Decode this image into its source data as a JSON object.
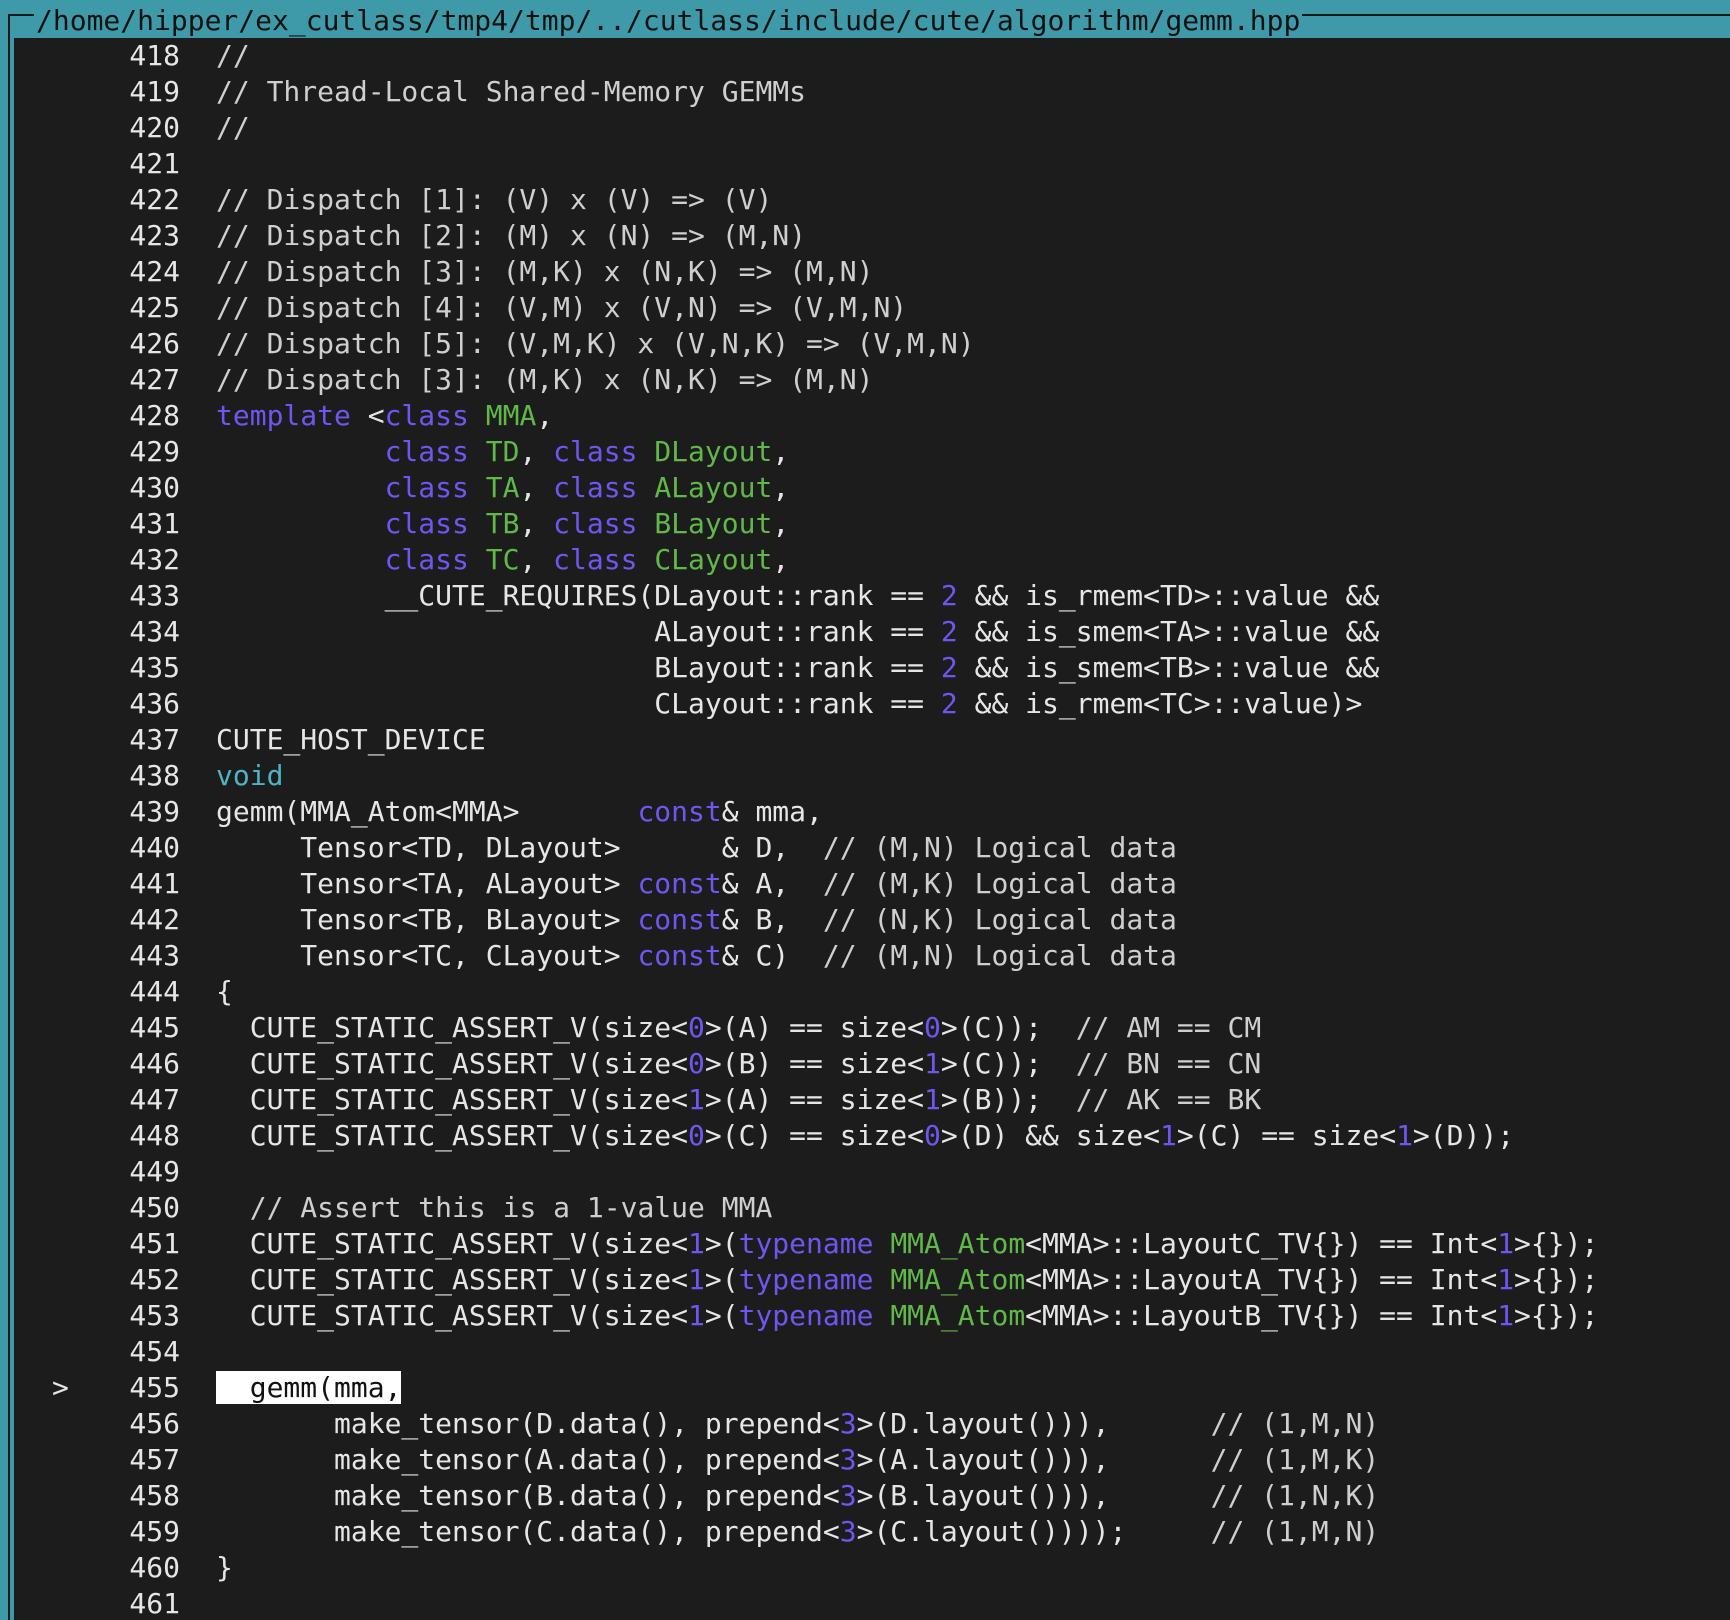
{
  "window": {
    "title": "/home/hipper/ex_cutlass/tmp4/tmp/../cutlass/include/cute/algorithm/gemm.hpp"
  },
  "editor": {
    "current_line_marker": ">",
    "current_line": 455,
    "colors": {
      "background": "#1c1c1c",
      "border": "#3e9aa8",
      "text": "#e6e6e6",
      "keyword": "#6f56f0",
      "type": "#5fb848",
      "number": "#6f56f0",
      "void": "#4eb3c3",
      "selection": "#ffffff"
    },
    "lines": [
      {
        "n": "418",
        "segs": [
          [
            "c",
            "//"
          ]
        ]
      },
      {
        "n": "419",
        "segs": [
          [
            "c",
            "// Thread-Local Shared-Memory GEMMs"
          ]
        ]
      },
      {
        "n": "420",
        "segs": [
          [
            "c",
            "//"
          ]
        ]
      },
      {
        "n": "421",
        "segs": []
      },
      {
        "n": "422",
        "segs": [
          [
            "c",
            "// Dispatch [1]: (V) x (V) => (V)"
          ]
        ]
      },
      {
        "n": "423",
        "segs": [
          [
            "c",
            "// Dispatch [2]: (M) x (N) => (M,N)"
          ]
        ]
      },
      {
        "n": "424",
        "segs": [
          [
            "c",
            "// Dispatch [3]: (M,K) x (N,K) => (M,N)"
          ]
        ]
      },
      {
        "n": "425",
        "segs": [
          [
            "c",
            "// Dispatch [4]: (V,M) x (V,N) => (V,M,N)"
          ]
        ]
      },
      {
        "n": "426",
        "segs": [
          [
            "c",
            "// Dispatch [5]: (V,M,K) x (V,N,K) => (V,M,N)"
          ]
        ]
      },
      {
        "n": "427",
        "segs": [
          [
            "c",
            "// Dispatch [3]: (M,K) x (N,K) => (M,N)"
          ]
        ]
      },
      {
        "n": "428",
        "segs": [
          [
            "k",
            "template"
          ],
          [
            "p",
            " <"
          ],
          [
            "k",
            "class"
          ],
          [
            "p",
            " "
          ],
          [
            "t",
            "MMA"
          ],
          [
            "p",
            ","
          ]
        ]
      },
      {
        "n": "429",
        "segs": [
          [
            "p",
            "          "
          ],
          [
            "k",
            "class"
          ],
          [
            "p",
            " "
          ],
          [
            "t",
            "TD"
          ],
          [
            "p",
            ", "
          ],
          [
            "k",
            "class"
          ],
          [
            "p",
            " "
          ],
          [
            "t",
            "DLayout"
          ],
          [
            "p",
            ","
          ]
        ]
      },
      {
        "n": "430",
        "segs": [
          [
            "p",
            "          "
          ],
          [
            "k",
            "class"
          ],
          [
            "p",
            " "
          ],
          [
            "t",
            "TA"
          ],
          [
            "p",
            ", "
          ],
          [
            "k",
            "class"
          ],
          [
            "p",
            " "
          ],
          [
            "t",
            "ALayout"
          ],
          [
            "p",
            ","
          ]
        ]
      },
      {
        "n": "431",
        "segs": [
          [
            "p",
            "          "
          ],
          [
            "k",
            "class"
          ],
          [
            "p",
            " "
          ],
          [
            "t",
            "TB"
          ],
          [
            "p",
            ", "
          ],
          [
            "k",
            "class"
          ],
          [
            "p",
            " "
          ],
          [
            "t",
            "BLayout"
          ],
          [
            "p",
            ","
          ]
        ]
      },
      {
        "n": "432",
        "segs": [
          [
            "p",
            "          "
          ],
          [
            "k",
            "class"
          ],
          [
            "p",
            " "
          ],
          [
            "t",
            "TC"
          ],
          [
            "p",
            ", "
          ],
          [
            "k",
            "class"
          ],
          [
            "p",
            " "
          ],
          [
            "t",
            "CLayout"
          ],
          [
            "p",
            ","
          ]
        ]
      },
      {
        "n": "433",
        "segs": [
          [
            "p",
            "          __CUTE_REQUIRES(DLayout::rank == "
          ],
          [
            "n",
            "2"
          ],
          [
            "p",
            " && is_rmem<TD>::value &&"
          ]
        ]
      },
      {
        "n": "434",
        "segs": [
          [
            "p",
            "                          ALayout::rank == "
          ],
          [
            "n",
            "2"
          ],
          [
            "p",
            " && is_smem<TA>::value &&"
          ]
        ]
      },
      {
        "n": "435",
        "segs": [
          [
            "p",
            "                          BLayout::rank == "
          ],
          [
            "n",
            "2"
          ],
          [
            "p",
            " && is_smem<TB>::value &&"
          ]
        ]
      },
      {
        "n": "436",
        "segs": [
          [
            "p",
            "                          CLayout::rank == "
          ],
          [
            "n",
            "2"
          ],
          [
            "p",
            " && is_rmem<TC>::value)>"
          ]
        ]
      },
      {
        "n": "437",
        "segs": [
          [
            "p",
            "CUTE_HOST_DEVICE"
          ]
        ]
      },
      {
        "n": "438",
        "segs": [
          [
            "v",
            "void"
          ]
        ]
      },
      {
        "n": "439",
        "segs": [
          [
            "p",
            "gemm(MMA_Atom<MMA>       "
          ],
          [
            "k",
            "const"
          ],
          [
            "p",
            "& mma,"
          ]
        ]
      },
      {
        "n": "440",
        "segs": [
          [
            "p",
            "     Tensor<TD, DLayout>      & D,  "
          ],
          [
            "c",
            "// (M,N) Logical data"
          ]
        ]
      },
      {
        "n": "441",
        "segs": [
          [
            "p",
            "     Tensor<TA, ALayout> "
          ],
          [
            "k",
            "const"
          ],
          [
            "p",
            "& A,  "
          ],
          [
            "c",
            "// (M,K) Logical data"
          ]
        ]
      },
      {
        "n": "442",
        "segs": [
          [
            "p",
            "     Tensor<TB, BLayout> "
          ],
          [
            "k",
            "const"
          ],
          [
            "p",
            "& B,  "
          ],
          [
            "c",
            "// (N,K) Logical data"
          ]
        ]
      },
      {
        "n": "443",
        "segs": [
          [
            "p",
            "     Tensor<TC, CLayout> "
          ],
          [
            "k",
            "const"
          ],
          [
            "p",
            "& C)  "
          ],
          [
            "c",
            "// (M,N) Logical data"
          ]
        ]
      },
      {
        "n": "444",
        "segs": [
          [
            "p",
            "{"
          ]
        ]
      },
      {
        "n": "445",
        "segs": [
          [
            "p",
            "  CUTE_STATIC_ASSERT_V(size<"
          ],
          [
            "n",
            "0"
          ],
          [
            "p",
            ">(A) == size<"
          ],
          [
            "n",
            "0"
          ],
          [
            "p",
            ">(C));  "
          ],
          [
            "c",
            "// AM == CM"
          ]
        ]
      },
      {
        "n": "446",
        "segs": [
          [
            "p",
            "  CUTE_STATIC_ASSERT_V(size<"
          ],
          [
            "n",
            "0"
          ],
          [
            "p",
            ">(B) == size<"
          ],
          [
            "n",
            "1"
          ],
          [
            "p",
            ">(C));  "
          ],
          [
            "c",
            "// BN == CN"
          ]
        ]
      },
      {
        "n": "447",
        "segs": [
          [
            "p",
            "  CUTE_STATIC_ASSERT_V(size<"
          ],
          [
            "n",
            "1"
          ],
          [
            "p",
            ">(A) == size<"
          ],
          [
            "n",
            "1"
          ],
          [
            "p",
            ">(B));  "
          ],
          [
            "c",
            "// AK == BK"
          ]
        ]
      },
      {
        "n": "448",
        "segs": [
          [
            "p",
            "  CUTE_STATIC_ASSERT_V(size<"
          ],
          [
            "n",
            "0"
          ],
          [
            "p",
            ">(C) == size<"
          ],
          [
            "n",
            "0"
          ],
          [
            "p",
            ">(D) && size<"
          ],
          [
            "n",
            "1"
          ],
          [
            "p",
            ">(C) == size<"
          ],
          [
            "n",
            "1"
          ],
          [
            "p",
            ">(D));"
          ]
        ]
      },
      {
        "n": "449",
        "segs": []
      },
      {
        "n": "450",
        "segs": [
          [
            "p",
            "  "
          ],
          [
            "c",
            "// Assert this is a 1-value MMA"
          ]
        ]
      },
      {
        "n": "451",
        "segs": [
          [
            "p",
            "  CUTE_STATIC_ASSERT_V(size<"
          ],
          [
            "n",
            "1"
          ],
          [
            "p",
            ">("
          ],
          [
            "k",
            "typename"
          ],
          [
            "p",
            " "
          ],
          [
            "t",
            "MMA_Atom"
          ],
          [
            "p",
            "<MMA>::LayoutC_TV{}) == Int<"
          ],
          [
            "n",
            "1"
          ],
          [
            "p",
            ">{});"
          ]
        ]
      },
      {
        "n": "452",
        "segs": [
          [
            "p",
            "  CUTE_STATIC_ASSERT_V(size<"
          ],
          [
            "n",
            "1"
          ],
          [
            "p",
            ">("
          ],
          [
            "k",
            "typename"
          ],
          [
            "p",
            " "
          ],
          [
            "t",
            "MMA_Atom"
          ],
          [
            "p",
            "<MMA>::LayoutA_TV{}) == Int<"
          ],
          [
            "n",
            "1"
          ],
          [
            "p",
            ">{});"
          ]
        ]
      },
      {
        "n": "453",
        "segs": [
          [
            "p",
            "  CUTE_STATIC_ASSERT_V(size<"
          ],
          [
            "n",
            "1"
          ],
          [
            "p",
            ">("
          ],
          [
            "k",
            "typename"
          ],
          [
            "p",
            " "
          ],
          [
            "t",
            "MMA_Atom"
          ],
          [
            "p",
            "<MMA>::LayoutB_TV{}) == Int<"
          ],
          [
            "n",
            "1"
          ],
          [
            "p",
            ">{});"
          ]
        ]
      },
      {
        "n": "454",
        "segs": []
      },
      {
        "n": "455",
        "segs": [
          [
            "s",
            "  gemm(mma,"
          ]
        ]
      },
      {
        "n": "456",
        "segs": [
          [
            "p",
            "       make_tensor(D.data(), prepend<"
          ],
          [
            "n",
            "3"
          ],
          [
            "p",
            ">(D.layout())),      "
          ],
          [
            "c",
            "// (1,M,N)"
          ]
        ]
      },
      {
        "n": "457",
        "segs": [
          [
            "p",
            "       make_tensor(A.data(), prepend<"
          ],
          [
            "n",
            "3"
          ],
          [
            "p",
            ">(A.layout())),      "
          ],
          [
            "c",
            "// (1,M,K)"
          ]
        ]
      },
      {
        "n": "458",
        "segs": [
          [
            "p",
            "       make_tensor(B.data(), prepend<"
          ],
          [
            "n",
            "3"
          ],
          [
            "p",
            ">(B.layout())),      "
          ],
          [
            "c",
            "// (1,N,K)"
          ]
        ]
      },
      {
        "n": "459",
        "segs": [
          [
            "p",
            "       make_tensor(C.data(), prepend<"
          ],
          [
            "n",
            "3"
          ],
          [
            "p",
            ">(C.layout())));     "
          ],
          [
            "c",
            "// (1,M,N)"
          ]
        ]
      },
      {
        "n": "460",
        "segs": [
          [
            "p",
            "}"
          ]
        ]
      },
      {
        "n": "461",
        "segs": []
      }
    ]
  }
}
